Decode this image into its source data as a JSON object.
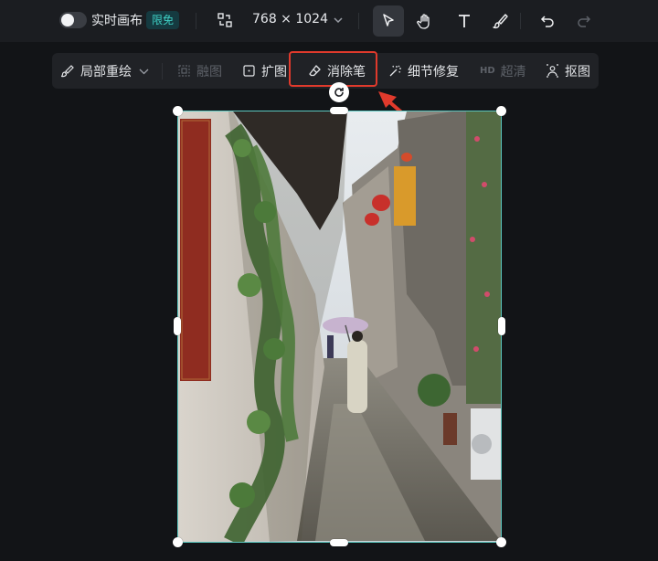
{
  "topbar": {
    "realtime_label": "实时画布",
    "badge": "限免",
    "canvas_size": "768 × 1024",
    "tools": [
      "select-tool",
      "hand-tool",
      "text-tool",
      "brush-tool",
      "undo",
      "redo"
    ]
  },
  "toolbar2": {
    "items": [
      {
        "label": "局部重绘",
        "icon": "repaint-icon",
        "disabled": false
      },
      {
        "label": "融图",
        "icon": "merge-icon",
        "disabled": true
      },
      {
        "label": "扩图",
        "icon": "expand-icon",
        "disabled": false
      },
      {
        "label": "消除笔",
        "icon": "eraser-icon",
        "disabled": false
      },
      {
        "label": "细节修复",
        "icon": "magic-wand-icon",
        "disabled": false
      },
      {
        "label": "超清",
        "icon": "hd-icon",
        "icon_text": "HD",
        "disabled": true
      },
      {
        "label": "抠图",
        "icon": "cutout-icon",
        "disabled": false
      }
    ]
  },
  "colors": {
    "accent": "#3fd0c5",
    "highlight": "#e03a2c",
    "selection": "#5bc8c0"
  }
}
